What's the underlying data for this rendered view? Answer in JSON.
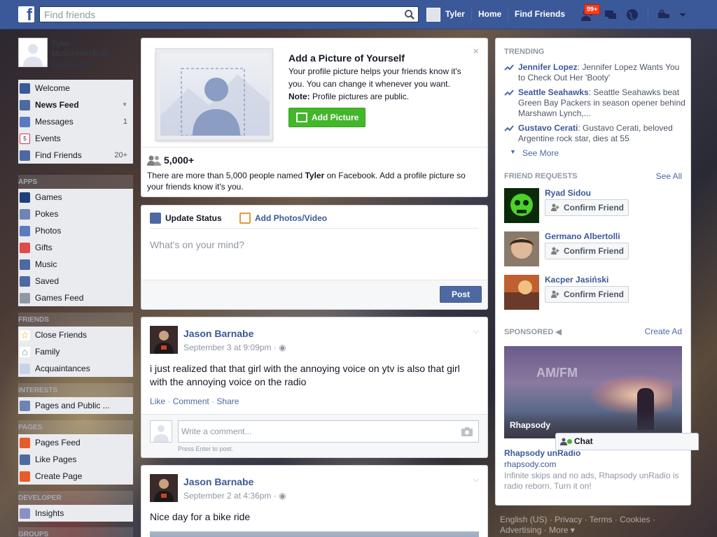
{
  "topbar": {
    "search_placeholder": "Find friends",
    "user_name": "Tyler",
    "home": "Home",
    "find_friends": "Find Friends",
    "notif_badge": "99+"
  },
  "sidebar": {
    "profile_name": "Tyler McScreenshots",
    "edit_profile": "Edit Profile",
    "main_items": [
      {
        "label": "Welcome",
        "count": "",
        "icon": "facebook-icon"
      },
      {
        "label": "News Feed",
        "count": "",
        "icon": "news-feed-icon"
      },
      {
        "label": "Messages",
        "count": "1",
        "icon": "messages-icon"
      },
      {
        "label": "Events",
        "count": "",
        "icon": "events-icon"
      },
      {
        "label": "Find Friends",
        "count": "20+",
        "icon": "find-friends-icon"
      }
    ],
    "apps_header": "APPS",
    "apps": [
      "Games",
      "Pokes",
      "Photos",
      "Gifts",
      "Music",
      "Saved",
      "Games Feed"
    ],
    "friends_header": "FRIENDS",
    "friends": [
      "Close Friends",
      "Family",
      "Acquaintances"
    ],
    "interests_header": "INTERESTS",
    "interests": [
      "Pages and Public ..."
    ],
    "pages_header": "PAGES",
    "pages": [
      "Pages Feed",
      "Like Pages",
      "Create Page"
    ],
    "developer_header": "DEVELOPER",
    "developer": [
      "Insights"
    ],
    "groups_header": "GROUPS"
  },
  "add_picture": {
    "title": "Add a Picture of Yourself",
    "desc": "Your profile picture helps your friends know it's you. You can change it whenever you want.",
    "note_label": "Note:",
    "note_text": "Profile pictures are public.",
    "button": "Add Picture",
    "close": "×",
    "people_count": "5,000+",
    "people_desc_pre": "There are more than 5,000 people named ",
    "people_desc_name": "Tyler",
    "people_desc_post": " on Facebook. Add a profile picture so your friends know it's you."
  },
  "composer": {
    "tab_status": "Update Status",
    "tab_photos": "Add Photos/Video",
    "placeholder": "What's on your mind?",
    "post_button": "Post"
  },
  "posts": [
    {
      "author": "Jason Barnabe",
      "date": "September 3 at 9:09pm · ",
      "body": "i just realized that that girl with the annoying voice on ytv is also that girl with the annoying voice on the radio",
      "like": "Like",
      "comment": "Comment",
      "share": "Share",
      "comment_placeholder": "Write a comment...",
      "comment_hint": "Press Enter to post."
    },
    {
      "author": "Jason Barnabe",
      "date": "September 2 at 4:36pm · ",
      "body": "Nice day for a bike ride"
    }
  ],
  "right": {
    "trending_header": "TRENDING",
    "trending": [
      {
        "name": "Jennifer Lopez",
        "text": ": Jennifer Lopez Wants You to Check Out Her 'Booty'"
      },
      {
        "name": "Seattle Seahawks",
        "text": ": Seattle Seahawks beat Green Bay Packers in season opener behind Marshawn Lynch,..."
      },
      {
        "name": "Gustavo Cerati",
        "text": ": Gustavo Cerati, beloved Argentine rock star, dies at 55"
      }
    ],
    "see_more": "See More",
    "friend_requests_header": "FRIEND REQUESTS",
    "see_all": "See All",
    "requests": [
      {
        "name": "Ryad Sidou",
        "button": "Confirm Friend"
      },
      {
        "name": "Germano Albertolli",
        "button": "Confirm Friend"
      },
      {
        "name": "Kacper Jasiński",
        "button": "Confirm Friend"
      }
    ],
    "sponsored_header": "SPONSORED",
    "create_ad": "Create Ad",
    "ad_title": "Rhapsody unRadio",
    "ad_url": "rhapsody.com",
    "ad_desc": "Infinite skips and no ads, Rhapsody unRadio is radio reborn. Turn it on!",
    "ad_img_text": "AM/FM",
    "ad_brand": "Rhapsody"
  },
  "chat": {
    "label": "Chat"
  },
  "footer": {
    "text": "English (US) · Privacy · Terms · Cookies · Advertising · More ▾"
  }
}
